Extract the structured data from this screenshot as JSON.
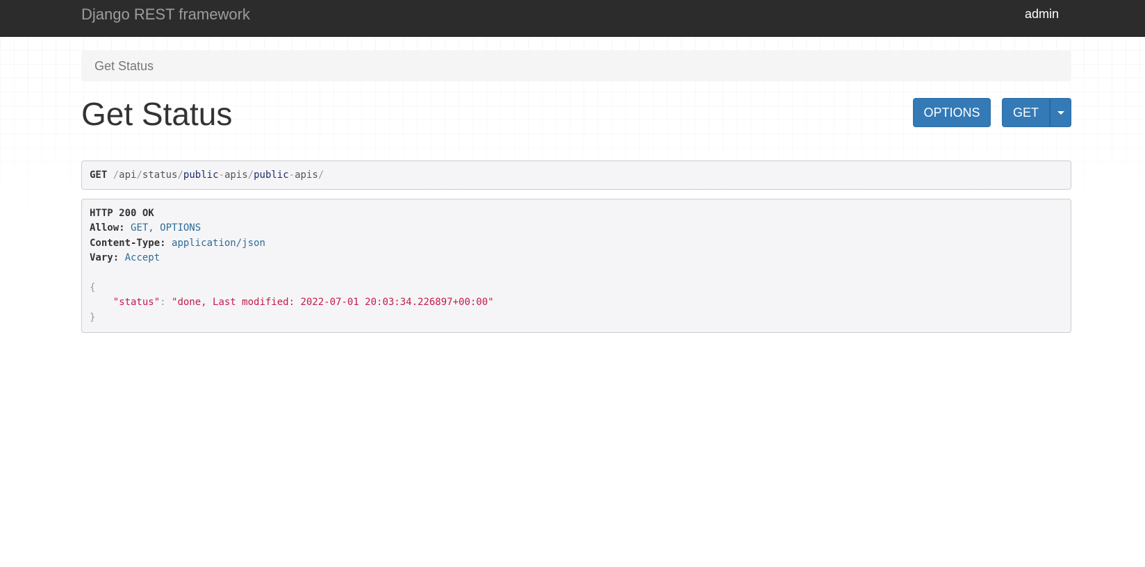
{
  "navbar": {
    "brand": "Django REST framework",
    "user": "admin"
  },
  "breadcrumb": {
    "current": "Get Status"
  },
  "page": {
    "title": "Get Status"
  },
  "buttons": {
    "options_label": "OPTIONS",
    "get_label": "GET"
  },
  "request": {
    "method": "GET",
    "path_parts": {
      "p1": "/",
      "p2": "api",
      "p3": "/",
      "p4": "status",
      "p5": "/",
      "p6": "public",
      "p7": "-",
      "p8": "apis",
      "p9": "/",
      "p10": "public",
      "p11": "-",
      "p12": "apis",
      "p13": "/"
    }
  },
  "response": {
    "status_line": "HTTP 200 OK",
    "headers": {
      "allow_name": "Allow:",
      "allow_value": "GET, OPTIONS",
      "content_type_name": "Content-Type:",
      "content_type_value": "application/json",
      "vary_name": "Vary:",
      "vary_value": "Accept"
    },
    "body": {
      "open_brace": "{",
      "key": "\"status\"",
      "colon": ": ",
      "value": "\"done, Last modified: 2022-07-01 20:03:34.226897+00:00\"",
      "close_brace": "}"
    }
  },
  "colors": {
    "navbar_bg": "#2c2c2c",
    "button_primary": "#337ab7",
    "breadcrumb_bg": "#f5f5f5",
    "pre_bg": "#f5f5f7",
    "json_string": "#c41a4a",
    "header_value": "#2d6b96"
  },
  "icons": {
    "dropdown": "caret-down-icon"
  }
}
